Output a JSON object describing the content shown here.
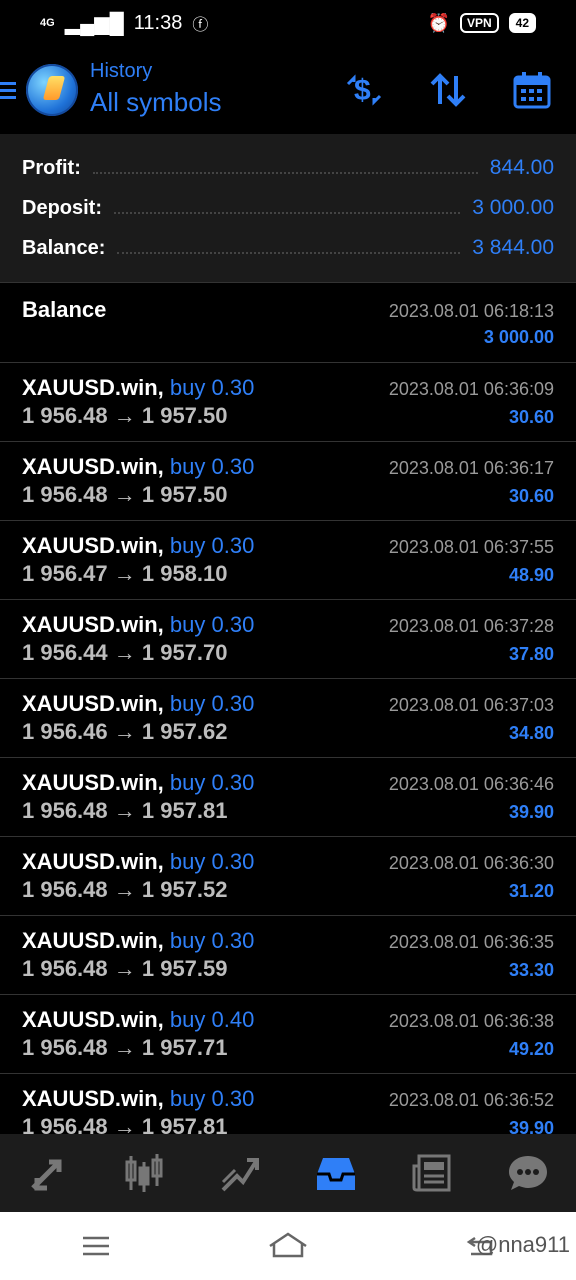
{
  "status": {
    "network1": "4G",
    "time": "11:38",
    "vpn": "VPN",
    "battery": "42"
  },
  "header": {
    "subtitle": "History",
    "title": "All symbols"
  },
  "summary": {
    "profit_label": "Profit:",
    "profit_value": "844.00",
    "deposit_label": "Deposit:",
    "deposit_value": "3 000.00",
    "balance_label": "Balance:",
    "balance_value": "3 844.00"
  },
  "balance_entry": {
    "name": "Balance",
    "time": "2023.08.01 06:18:13",
    "amount": "3 000.00"
  },
  "trades": [
    {
      "symbol": "XAUUSD.win,",
      "side": "buy 0.30",
      "prices": "1 956.48 → 1 957.50",
      "time": "2023.08.01 06:36:09",
      "profit": "30.60"
    },
    {
      "symbol": "XAUUSD.win,",
      "side": "buy 0.30",
      "prices": "1 956.48 → 1 957.50",
      "time": "2023.08.01 06:36:17",
      "profit": "30.60"
    },
    {
      "symbol": "XAUUSD.win,",
      "side": "buy 0.30",
      "prices": "1 956.47 → 1 958.10",
      "time": "2023.08.01 06:37:55",
      "profit": "48.90"
    },
    {
      "symbol": "XAUUSD.win,",
      "side": "buy 0.30",
      "prices": "1 956.44 → 1 957.70",
      "time": "2023.08.01 06:37:28",
      "profit": "37.80"
    },
    {
      "symbol": "XAUUSD.win,",
      "side": "buy 0.30",
      "prices": "1 956.46 → 1 957.62",
      "time": "2023.08.01 06:37:03",
      "profit": "34.80"
    },
    {
      "symbol": "XAUUSD.win,",
      "side": "buy 0.30",
      "prices": "1 956.48 → 1 957.81",
      "time": "2023.08.01 06:36:46",
      "profit": "39.90"
    },
    {
      "symbol": "XAUUSD.win,",
      "side": "buy 0.30",
      "prices": "1 956.48 → 1 957.52",
      "time": "2023.08.01 06:36:30",
      "profit": "31.20"
    },
    {
      "symbol": "XAUUSD.win,",
      "side": "buy 0.30",
      "prices": "1 956.48 → 1 957.59",
      "time": "2023.08.01 06:36:35",
      "profit": "33.30"
    },
    {
      "symbol": "XAUUSD.win,",
      "side": "buy 0.40",
      "prices": "1 956.48 → 1 957.71",
      "time": "2023.08.01 06:36:38",
      "profit": "49.20"
    },
    {
      "symbol": "XAUUSD.win,",
      "side": "buy 0.30",
      "prices": "1 956.48 → 1 957.81",
      "time": "2023.08.01 06:36:52",
      "profit": "39.90"
    }
  ],
  "tabs": [
    {
      "icon": "trade-arrows-icon",
      "active": false
    },
    {
      "icon": "candlestick-chart-icon",
      "active": false
    },
    {
      "icon": "chart-trend-icon",
      "active": false
    },
    {
      "icon": "history-inbox-icon",
      "active": true
    },
    {
      "icon": "news-icon",
      "active": false
    },
    {
      "icon": "chat-icon",
      "active": false
    }
  ],
  "watermark": "@nna911",
  "colors": {
    "accent": "#2f7ff7",
    "background": "#000000",
    "summary_bg": "#1b1b1b"
  }
}
